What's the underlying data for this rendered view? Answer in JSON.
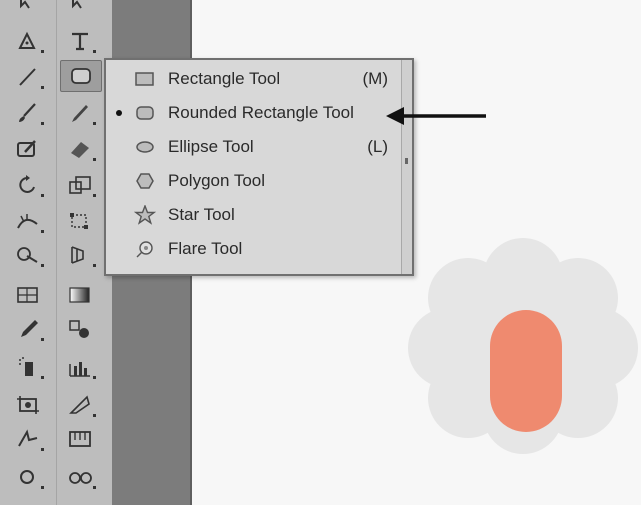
{
  "toolbox": {
    "tools": [
      {
        "name": "direct-selection-icon"
      },
      {
        "name": "group-selection-icon"
      },
      {
        "name": "pen-icon"
      },
      {
        "name": "type-icon"
      },
      {
        "name": "line-segment-icon"
      },
      {
        "name": "rounded-rectangle-icon"
      },
      {
        "name": "paintbrush-icon"
      },
      {
        "name": "pencil-icon"
      },
      {
        "name": "blob-brush-icon"
      },
      {
        "name": "eraser-icon"
      },
      {
        "name": "rotate-icon"
      },
      {
        "name": "scale-icon"
      },
      {
        "name": "width-icon"
      },
      {
        "name": "free-transform-icon"
      },
      {
        "name": "shape-builder-icon"
      },
      {
        "name": "perspective-grid-icon"
      },
      {
        "name": "mesh-icon"
      },
      {
        "name": "gradient-icon"
      },
      {
        "name": "eyedropper-icon"
      },
      {
        "name": "blend-icon"
      },
      {
        "name": "symbol-sprayer-icon"
      },
      {
        "name": "column-graph-icon"
      },
      {
        "name": "artboard-icon"
      },
      {
        "name": "slice-icon"
      },
      {
        "name": "hand-icon"
      },
      {
        "name": "zoom-icon"
      },
      {
        "name": "ellipse-tool-icon"
      },
      {
        "name": "glasses-icon"
      }
    ]
  },
  "flyout": {
    "items": [
      {
        "label": "Rectangle Tool",
        "shortcut": "(M)",
        "icon": "rectangle-icon",
        "selected": false
      },
      {
        "label": "Rounded Rectangle Tool",
        "shortcut": "",
        "icon": "rounded-rectangle-icon",
        "selected": true
      },
      {
        "label": "Ellipse Tool",
        "shortcut": "(L)",
        "icon": "ellipse-icon",
        "selected": false
      },
      {
        "label": "Polygon Tool",
        "shortcut": "",
        "icon": "polygon-icon",
        "selected": false
      },
      {
        "label": "Star Tool",
        "shortcut": "",
        "icon": "star-icon",
        "selected": false
      },
      {
        "label": "Flare Tool",
        "shortcut": "",
        "icon": "flare-icon",
        "selected": false
      }
    ]
  },
  "colors": {
    "toolbox_bg": "#bdbdbd",
    "panel_strip": "#7c7c7c",
    "menu_bg": "#d8d8d8",
    "flower_fill": "#e6e6e6",
    "capsule_fill": "#ef8a6f",
    "arrow": "#111111"
  }
}
